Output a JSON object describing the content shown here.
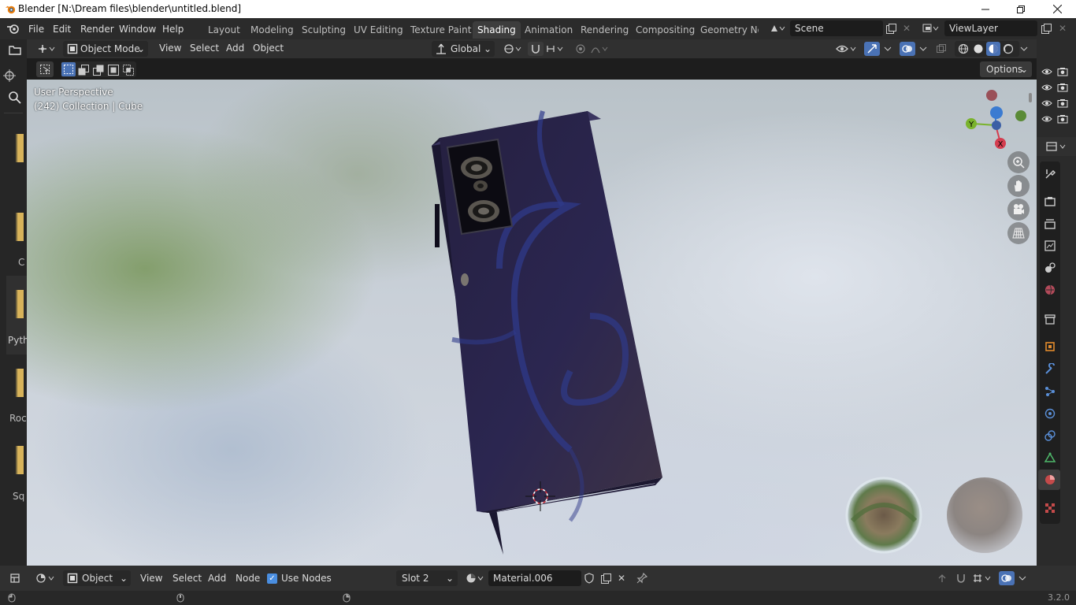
{
  "window": {
    "title": "Blender [N:\\Dream files\\blender\\untitled.blend]"
  },
  "menu": {
    "items": [
      "File",
      "Edit",
      "Render",
      "Window",
      "Help"
    ]
  },
  "workspaces": {
    "tabs": [
      "Layout",
      "Modeling",
      "Sculpting",
      "UV Editing",
      "Texture Paint",
      "Shading",
      "Animation",
      "Rendering",
      "Compositing",
      "Geometry Noc"
    ],
    "active": "Shading"
  },
  "scene": {
    "name": "Scene",
    "view_layer": "ViewLayer"
  },
  "viewport_header": {
    "mode": "Object Mode",
    "menus": [
      "View",
      "Select",
      "Add",
      "Object"
    ],
    "orientation": "Global",
    "options_label": "Options"
  },
  "viewport": {
    "perspective_label": "User Perspective",
    "collection_label": "(242) Collection | Cube",
    "gizmo": {
      "x": "X",
      "y": "Y"
    }
  },
  "left_panel_fragments": [
    "C",
    "Pyth",
    "Roc",
    "Sq"
  ],
  "node_header": {
    "editor_mode": "Object",
    "menus": [
      "View",
      "Select",
      "Add",
      "Node"
    ],
    "use_nodes_label": "Use Nodes",
    "use_nodes_checked": true,
    "slot": "Slot 2",
    "material": "Material.006"
  },
  "statusbar": {
    "version": "3.2.0"
  },
  "colors": {
    "accent_blue": "#4a8ee0",
    "phone_body": "#2a2548",
    "axis_x": "#d43d4f",
    "axis_y": "#7ab32d",
    "axis_z": "#3b7bd1"
  }
}
